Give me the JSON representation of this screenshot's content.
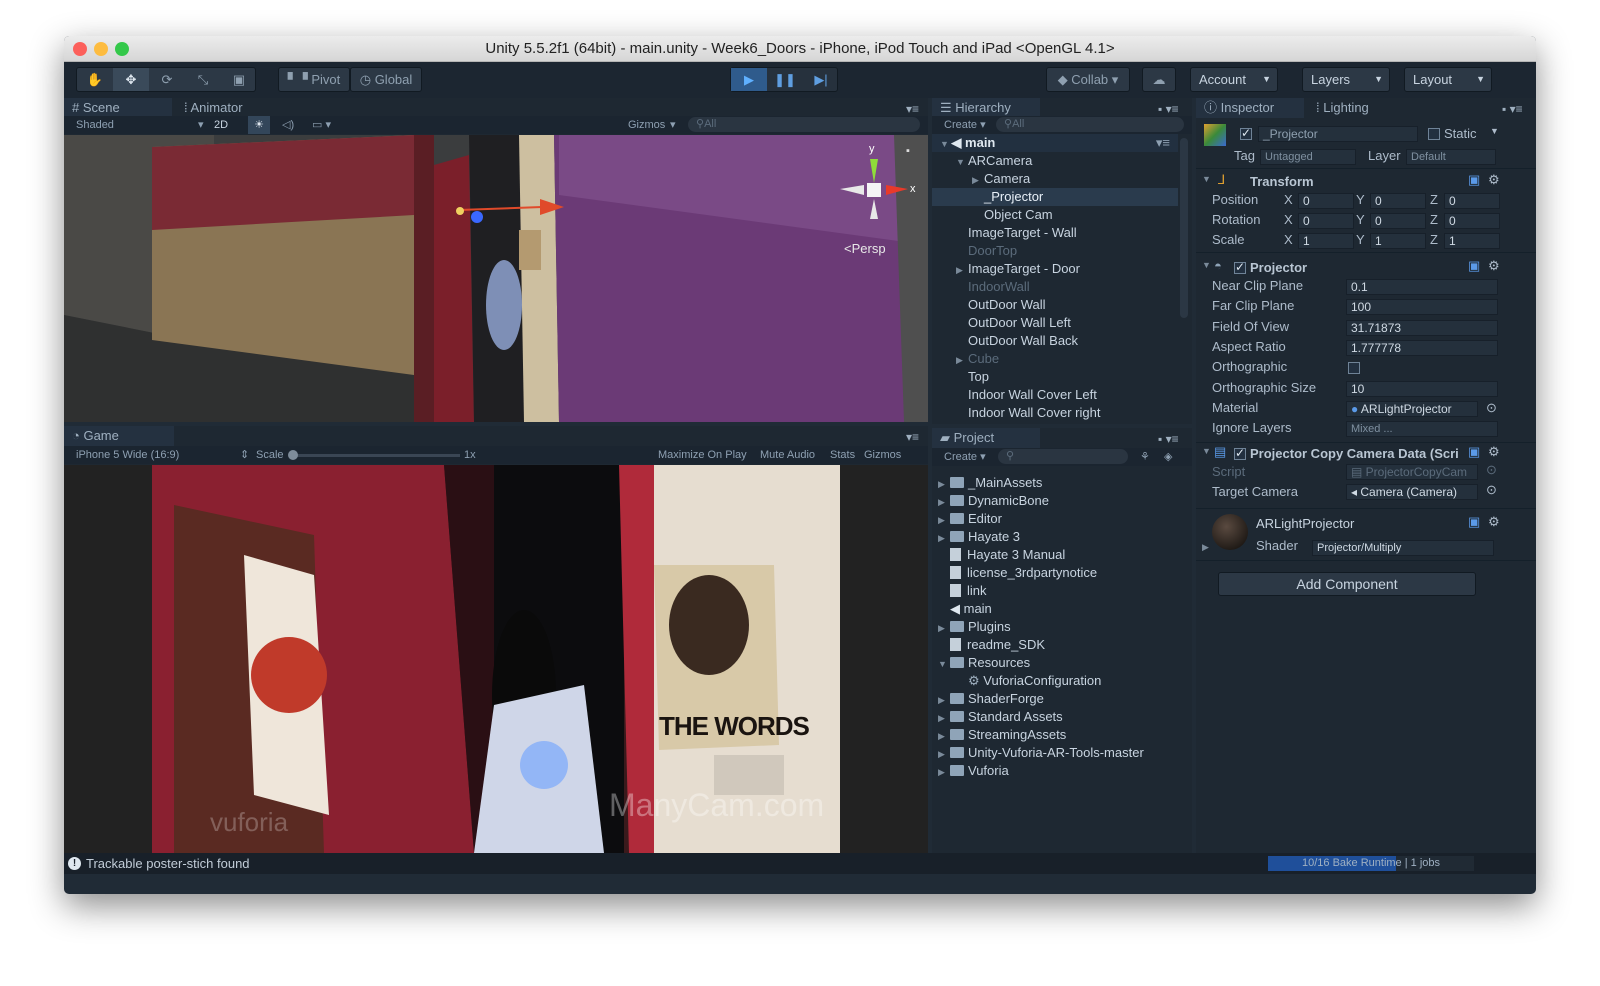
{
  "window": {
    "title": "Unity 5.5.2f1 (64bit) - main.unity - Week6_Doors - iPhone, iPod Touch and iPad <OpenGL 4.1>"
  },
  "toolbar": {
    "tools": [
      "hand-icon",
      "move-icon",
      "rotate-icon",
      "scale-icon",
      "rect-icon"
    ],
    "pivot": "Pivot",
    "global": "Global",
    "collab": "Collab",
    "account": "Account",
    "layers": "Layers",
    "layout": "Layout"
  },
  "scene": {
    "tabs": [
      "Scene",
      "Animator"
    ],
    "shading": "Shaded",
    "mode2d": "2D",
    "gizmos": "Gizmos",
    "search": "All",
    "persp": "Persp",
    "axis_y": "y",
    "axis_x": "x"
  },
  "game": {
    "tab": "Game",
    "aspect": "iPhone 5 Wide (16:9)",
    "scale_label": "Scale",
    "scale_value": "1x",
    "maximize": "Maximize On Play",
    "mute": "Mute Audio",
    "stats": "Stats",
    "gizmos": "Gizmos",
    "poster_text": "THE WORDS",
    "watermark": "ManyCam.com",
    "vuforia": "vuforia"
  },
  "hierarchy": {
    "tab": "Hierarchy",
    "create": "Create",
    "search": "All",
    "root": "main",
    "items": [
      {
        "label": "ARCamera",
        "indent": 1,
        "arrow": "▼",
        "dim": false,
        "sel": false
      },
      {
        "label": "Camera",
        "indent": 2,
        "arrow": "▶",
        "dim": false,
        "sel": false
      },
      {
        "label": "_Projector",
        "indent": 2,
        "arrow": "",
        "dim": false,
        "sel": true
      },
      {
        "label": "Object Cam",
        "indent": 2,
        "arrow": "",
        "dim": false,
        "sel": false
      },
      {
        "label": "ImageTarget - Wall",
        "indent": 1,
        "arrow": "",
        "dim": false,
        "sel": false
      },
      {
        "label": "DoorTop",
        "indent": 1,
        "arrow": "",
        "dim": true,
        "sel": false
      },
      {
        "label": "ImageTarget - Door",
        "indent": 1,
        "arrow": "▶",
        "dim": false,
        "sel": false
      },
      {
        "label": "IndoorWall",
        "indent": 1,
        "arrow": "",
        "dim": true,
        "sel": false
      },
      {
        "label": "OutDoor Wall",
        "indent": 1,
        "arrow": "",
        "dim": false,
        "sel": false
      },
      {
        "label": "OutDoor Wall Left",
        "indent": 1,
        "arrow": "",
        "dim": false,
        "sel": false
      },
      {
        "label": "OutDoor Wall Back",
        "indent": 1,
        "arrow": "",
        "dim": false,
        "sel": false
      },
      {
        "label": "Cube",
        "indent": 1,
        "arrow": "▶",
        "dim": true,
        "sel": false
      },
      {
        "label": "Top",
        "indent": 1,
        "arrow": "",
        "dim": false,
        "sel": false
      },
      {
        "label": "Indoor Wall Cover Left",
        "indent": 1,
        "arrow": "",
        "dim": false,
        "sel": false
      },
      {
        "label": "Indoor Wall Cover right",
        "indent": 1,
        "arrow": "",
        "dim": false,
        "sel": false
      }
    ]
  },
  "project": {
    "tab": "Project",
    "create": "Create",
    "items": [
      {
        "label": "_MainAssets",
        "type": "folder",
        "indent": 0,
        "arrow": "▶"
      },
      {
        "label": "DynamicBone",
        "type": "folder",
        "indent": 0,
        "arrow": "▶"
      },
      {
        "label": "Editor",
        "type": "folder",
        "indent": 0,
        "arrow": "▶"
      },
      {
        "label": "Hayate 3",
        "type": "folder",
        "indent": 0,
        "arrow": "▶"
      },
      {
        "label": "Hayate 3 Manual",
        "type": "doc",
        "indent": 0,
        "arrow": ""
      },
      {
        "label": "license_3rdpartynotice",
        "type": "doc",
        "indent": 0,
        "arrow": ""
      },
      {
        "label": "link",
        "type": "doc",
        "indent": 0,
        "arrow": ""
      },
      {
        "label": "main",
        "type": "unity",
        "indent": 0,
        "arrow": ""
      },
      {
        "label": "Plugins",
        "type": "folder",
        "indent": 0,
        "arrow": "▶"
      },
      {
        "label": "readme_SDK",
        "type": "doc",
        "indent": 0,
        "arrow": ""
      },
      {
        "label": "Resources",
        "type": "folder",
        "indent": 0,
        "arrow": "▼"
      },
      {
        "label": "VuforiaConfiguration",
        "type": "config",
        "indent": 1,
        "arrow": ""
      },
      {
        "label": "ShaderForge",
        "type": "folder",
        "indent": 0,
        "arrow": "▶"
      },
      {
        "label": "Standard Assets",
        "type": "folder",
        "indent": 0,
        "arrow": "▶"
      },
      {
        "label": "StreamingAssets",
        "type": "folder",
        "indent": 0,
        "arrow": "▶"
      },
      {
        "label": "Unity-Vuforia-AR-Tools-master",
        "type": "folder",
        "indent": 0,
        "arrow": "▶"
      },
      {
        "label": "Vuforia",
        "type": "folder",
        "indent": 0,
        "arrow": "▶"
      }
    ]
  },
  "inspector": {
    "tabs": [
      "Inspector",
      "Lighting"
    ],
    "object_name": "_Projector",
    "static": "Static",
    "tag_label": "Tag",
    "tag_value": "Untagged",
    "layer_label": "Layer",
    "layer_value": "Default",
    "transform": {
      "title": "Transform",
      "rows": [
        {
          "label": "Position",
          "x": "0",
          "y": "0",
          "z": "0"
        },
        {
          "label": "Rotation",
          "x": "0",
          "y": "0",
          "z": "0"
        },
        {
          "label": "Scale",
          "x": "1",
          "y": "1",
          "z": "1"
        }
      ],
      "xl": "X",
      "yl": "Y",
      "zl": "Z"
    },
    "projector": {
      "title": "Projector",
      "rows": [
        {
          "label": "Near Clip Plane",
          "value": "0.1"
        },
        {
          "label": "Far Clip Plane",
          "value": "100"
        },
        {
          "label": "Field Of View",
          "value": "31.71873"
        },
        {
          "label": "Aspect Ratio",
          "value": "1.777778"
        },
        {
          "label": "Orthographic",
          "value": ""
        },
        {
          "label": "Orthographic Size",
          "value": "10"
        },
        {
          "label": "Material",
          "value": "ARLightProjector"
        },
        {
          "label": "Ignore Layers",
          "value": "Mixed ..."
        }
      ]
    },
    "copycam": {
      "title": "Projector Copy Camera Data (Scri",
      "script_label": "Script",
      "script_value": "ProjectorCopyCam",
      "target_label": "Target Camera",
      "target_value": "Camera (Camera)"
    },
    "material": {
      "name": "ARLightProjector",
      "shader_label": "Shader",
      "shader_value": "Projector/Multiply"
    },
    "add_component": "Add Component"
  },
  "status": {
    "message": "Trackable poster-stich found",
    "progress_text": "10/16 Bake Runtime | 1 jobs",
    "progress": 0.62
  }
}
